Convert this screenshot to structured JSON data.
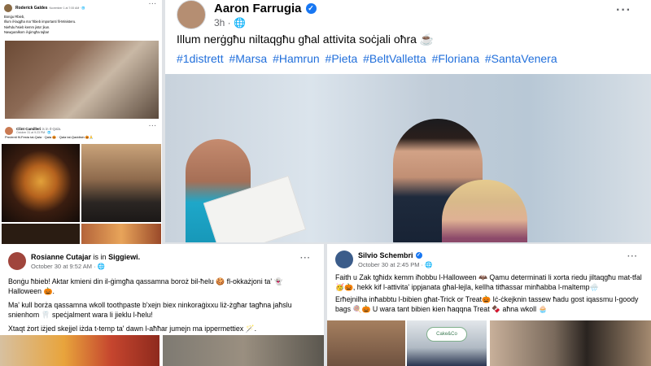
{
  "posts": {
    "a": {
      "author": "Roderick Galdes",
      "meta": "November 1 at 7:00 AM · 🌐",
      "text": [
        "Bonġu Ħbieb,",
        "Illum il-laqgħa ma' ħbieb importanti fil-Ministeru.",
        "Nieħdu ħsieb kemm jista' jkun.",
        "Nawguralkom il-ġimgħa tajba!"
      ]
    },
    "b": {
      "author": "Clint Camilleri",
      "location_suffix": "is in Il-Qala.",
      "meta": "October 31 at 9:23 PM · 🌐",
      "text": "Preżenti fil-Festa tal-Qala · Qala 🎃 · Qala tal-Qaddisin 🎃🙏"
    },
    "c": {
      "author": "Aaron Farrugia",
      "meta": "3h · 🌐",
      "text": "Illum nerġgħu niltaqgħu għal attivita soċjali oħra ☕",
      "hashtags": [
        "#1distrett",
        "#Marsa",
        "#Hamrun",
        "#Pieta",
        "#BeltValletta",
        "#Floriana",
        "#SantaVenera"
      ]
    },
    "d": {
      "author": "Rosianne Cutajar",
      "location_prefix": "is in",
      "location": "Siggiewi.",
      "meta": "October 30 at 9:52 AM · 🌐",
      "text": [
        "Bonġu ħbieb! Aktar kmieni din il-ġimgħa qassamna boroż bil-ħelu 🍪 fl-okkażjoni ta' 👻 Halloween 🎃.",
        "Ma' kull borża qassamna wkoll toothpaste b'xejn biex ninkoraġixxu liż-żgħar tagħna jaħslu snienhom 🦷 speċjalment wara li jieklu l-ħelu!",
        "Xtaqt żort iżjed skejjel iżda t-temp ta' dawn l-aħħar jumejn ma ippermettiex 🪄."
      ]
    },
    "e": {
      "author": "Silvio Schembri",
      "meta": "October 30 at 2:45 PM · 🌐",
      "text": [
        "Faith u Zak tgħidx kemm iħobbu l-Halloween 🦇 Qamu determinati li xorta riedu jiltaqgħu mat-tfal🥳🎃, hekk kif l-attivita' ippjanata għal-lejla, kellha titħassar minħabba l-maltemp🌧️",
        "Erħejnilha inħabbtu l-bibien għat-Trick or Treat🎃 Iċ-ċkejknin tassew ħadu gost iqassmu l-goody bags 🍭🎃 U wara tant bibien kien ħaqqna Treat 🍫 aħna wkoll 🧁"
      ],
      "shop_logo": "Cake&Co"
    }
  }
}
